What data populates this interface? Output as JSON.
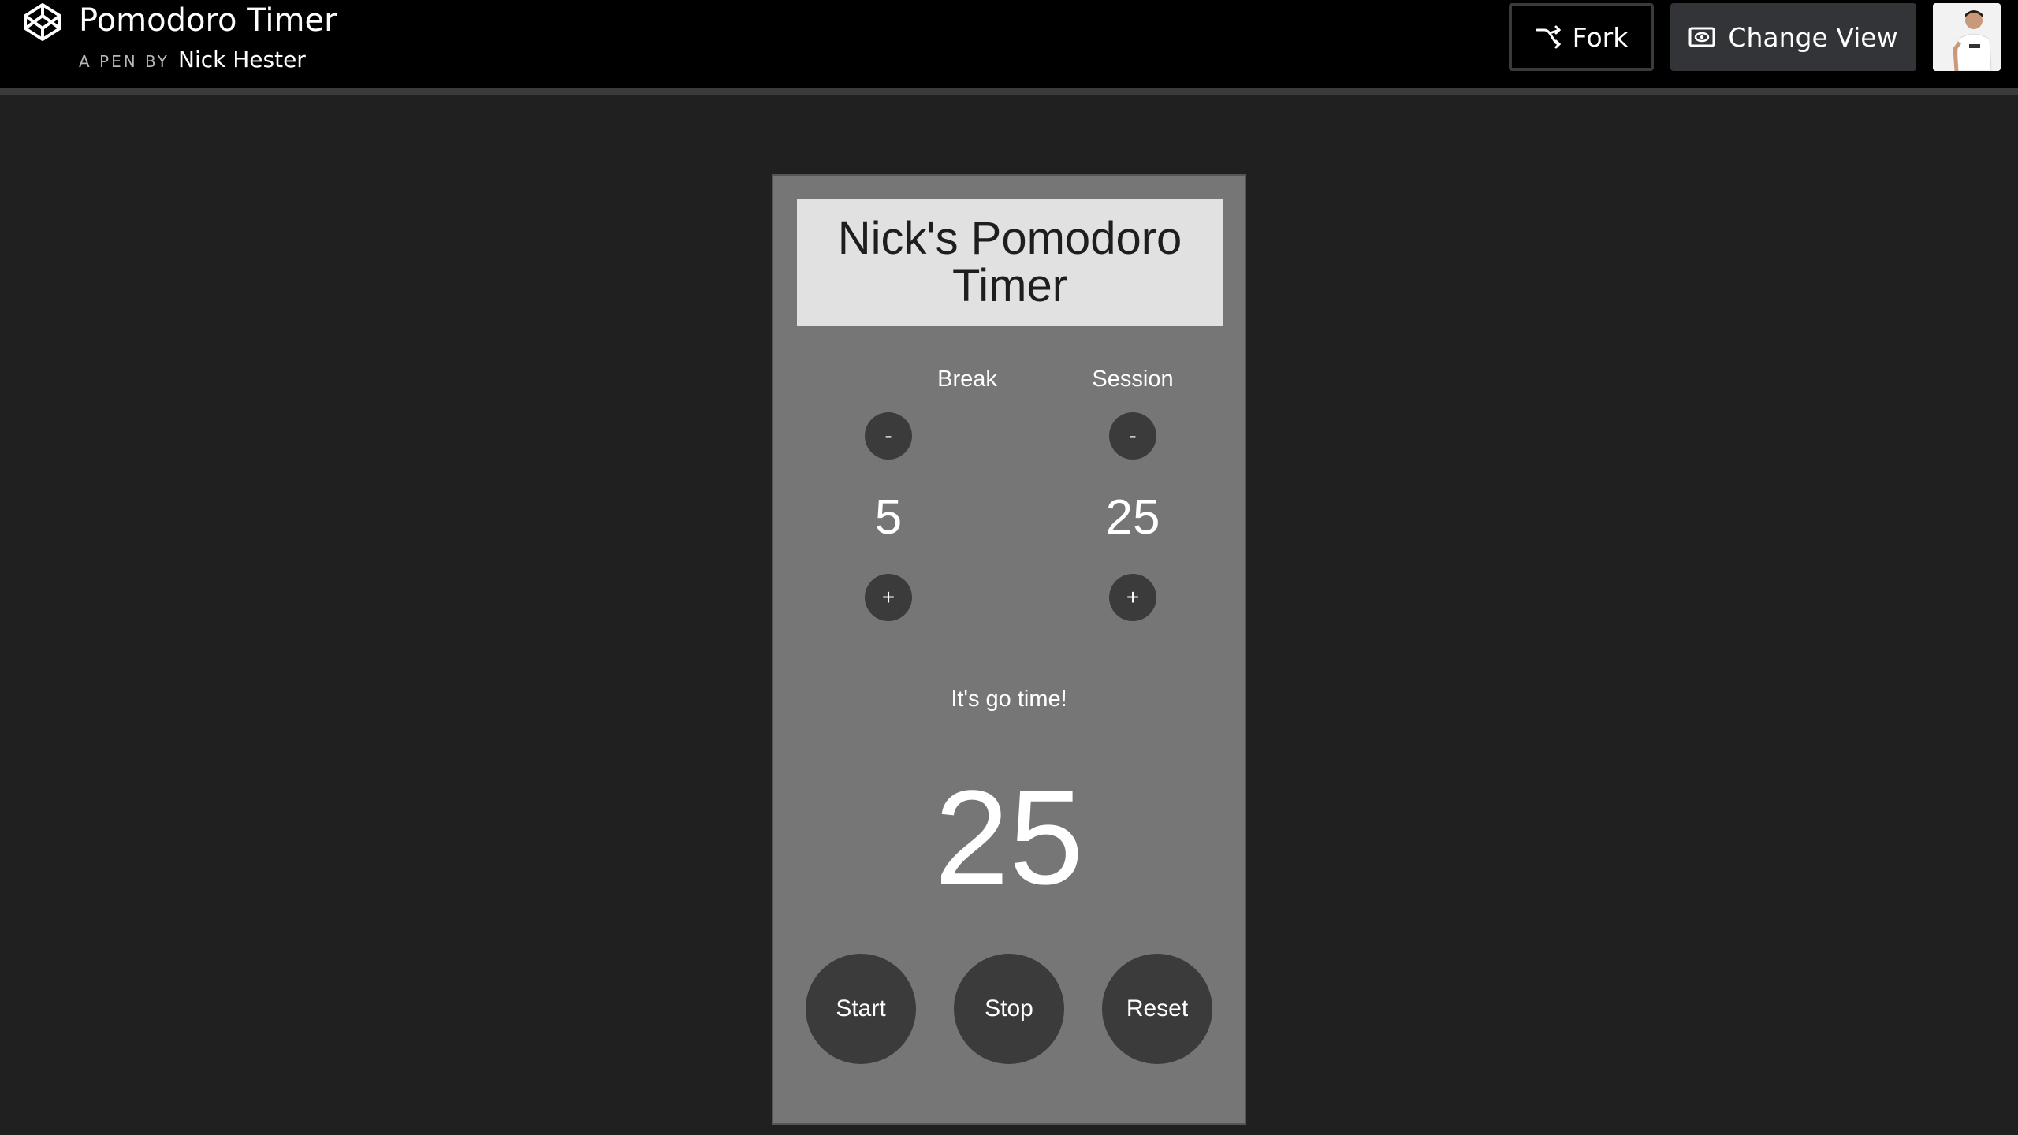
{
  "header": {
    "pen_title": "Pomodoro Timer",
    "pen_by_prefix": "A PEN BY",
    "author": "Nick Hester",
    "fork_label": "Fork",
    "change_view_label": "Change View",
    "logo_icon": "codepen-logo-icon",
    "fork_icon": "fork-icon",
    "change_view_icon": "eye-icon"
  },
  "timer": {
    "title": "Nick's Pomodoro Timer",
    "break_label": "Break",
    "session_label": "Session",
    "decrement_label": "-",
    "increment_label": "+",
    "break_value": "5",
    "session_value": "25",
    "status_text": "It's go time!",
    "display_value": "25",
    "start_label": "Start",
    "stop_label": "Stop",
    "reset_label": "Reset"
  },
  "colors": {
    "page_background": "#202020",
    "header_background": "#000000",
    "card_background": "#767676",
    "title_box_background": "#e1e1e1",
    "button_background": "#3b3b3b"
  }
}
